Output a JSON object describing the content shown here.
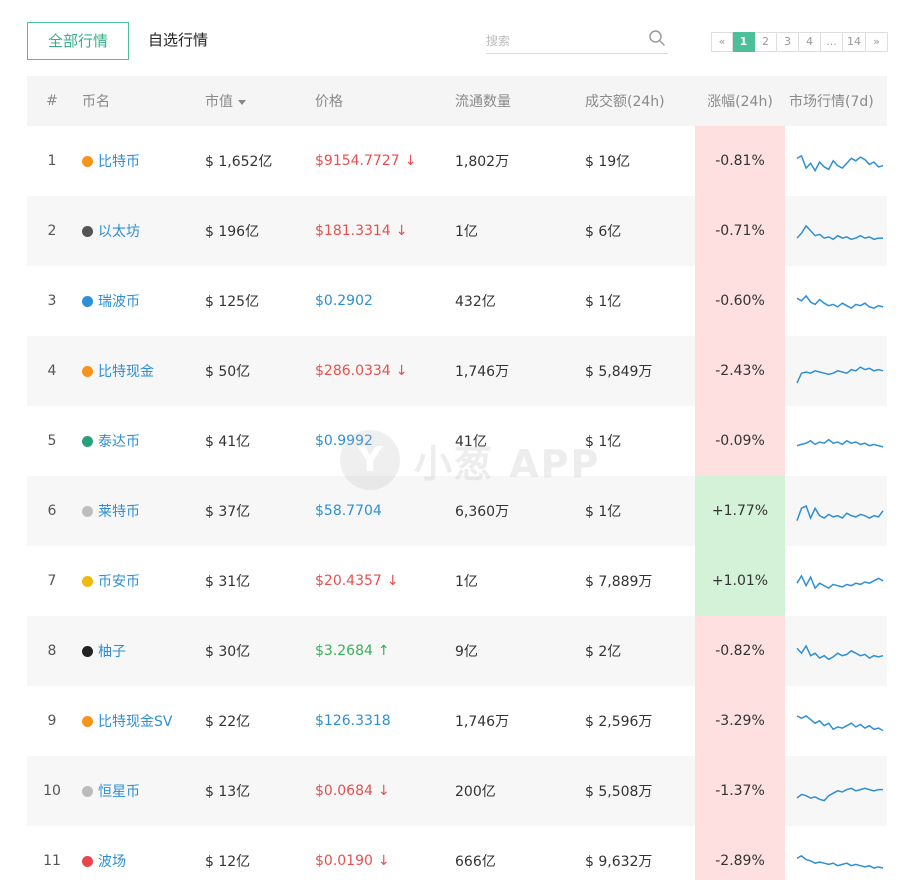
{
  "tabs": [
    {
      "label": "全部行情",
      "active": true
    },
    {
      "label": "自选行情",
      "active": false
    }
  ],
  "search": {
    "placeholder": "搜索",
    "value": ""
  },
  "pagination": {
    "prev_icon": "double-chevron-left-icon",
    "pages": [
      "1",
      "2",
      "3",
      "4",
      "...",
      "14"
    ],
    "current": "1",
    "next_icon": "double-chevron-right-icon"
  },
  "table": {
    "headers": {
      "rank": "#",
      "name": "币名",
      "market_cap": "市值",
      "price": "价格",
      "supply": "流通数量",
      "volume": "成交额(24h)",
      "change": "涨幅(24h)",
      "trend": "市场行情(7d)"
    },
    "rows": [
      {
        "rank": "1",
        "name": "比特币",
        "icon": "bitcoin-icon",
        "icon_color": "#f7931a",
        "market_cap": "$ 1,652亿",
        "price": "$9154.7727",
        "price_dir": "down",
        "supply": "1,802万",
        "volume": "$ 19亿",
        "change": "-0.81%",
        "change_dir": "neg",
        "spark": [
          6,
          4,
          14,
          10,
          16,
          9,
          13,
          15,
          8,
          12,
          14,
          10,
          6,
          8,
          5,
          7,
          11,
          9,
          13,
          12
        ],
        "spark_max": 18
      },
      {
        "rank": "2",
        "name": "以太坊",
        "icon": "ethereum-icon",
        "icon_color": "#555555",
        "market_cap": "$ 196亿",
        "price": "$181.3314",
        "price_dir": "down",
        "supply": "1亿",
        "volume": "$ 6亿",
        "change": "-0.71%",
        "change_dir": "neg",
        "spark": [
          14,
          10,
          4,
          8,
          12,
          11,
          14,
          13,
          15,
          12,
          14,
          13,
          15,
          14,
          12,
          14,
          13,
          15,
          14,
          14
        ],
        "spark_max": 18
      },
      {
        "rank": "3",
        "name": "瑞波币",
        "icon": "ripple-icon",
        "icon_color": "#2d8fd5",
        "market_cap": "$ 125亿",
        "price": "$0.2902",
        "price_dir": "flat",
        "supply": "432亿",
        "volume": "$ 1亿",
        "change": "-0.60%",
        "change_dir": "neg",
        "spark": [
          6,
          8,
          4,
          9,
          11,
          7,
          10,
          12,
          11,
          13,
          10,
          12,
          14,
          11,
          12,
          10,
          13,
          14,
          12,
          13
        ],
        "spark_max": 18
      },
      {
        "rank": "4",
        "name": "比特现金",
        "icon": "bitcoin-cash-icon",
        "icon_color": "#f7931a",
        "market_cap": "$ 50亿",
        "price": "$286.0334",
        "price_dir": "down",
        "supply": "1,746万",
        "volume": "$ 5,849万",
        "change": "-2.43%",
        "change_dir": "neg",
        "spark": [
          18,
          10,
          9,
          10,
          8,
          9,
          10,
          11,
          10,
          8,
          9,
          10,
          7,
          8,
          5,
          7,
          6,
          8,
          7,
          8
        ],
        "spark_max": 18
      },
      {
        "rank": "5",
        "name": "泰达币",
        "icon": "tether-icon",
        "icon_color": "#26a17b",
        "market_cap": "$ 41亿",
        "price": "$0.9992",
        "price_dir": "flat",
        "supply": "41亿",
        "volume": "$ 1亿",
        "change": "-0.09%",
        "change_dir": "neg",
        "spark": [
          12,
          11,
          10,
          8,
          11,
          9,
          10,
          7,
          10,
          9,
          11,
          8,
          10,
          9,
          11,
          10,
          12,
          11,
          12,
          13
        ],
        "spark_max": 18
      },
      {
        "rank": "6",
        "name": "莱特币",
        "icon": "litecoin-icon",
        "icon_color": "#bebebe",
        "market_cap": "$ 37亿",
        "price": "$58.7704",
        "price_dir": "flat",
        "supply": "6,360万",
        "volume": "$ 1亿",
        "change": "+1.77%",
        "change_dir": "pos",
        "spark": [
          16,
          6,
          4,
          14,
          6,
          12,
          14,
          11,
          13,
          12,
          14,
          10,
          12,
          13,
          11,
          12,
          14,
          12,
          13,
          8
        ],
        "spark_max": 18
      },
      {
        "rank": "7",
        "name": "币安币",
        "icon": "binance-icon",
        "icon_color": "#f0b90b",
        "market_cap": "$ 31亿",
        "price": "$20.4357",
        "price_dir": "down",
        "supply": "1亿",
        "volume": "$ 7,889万",
        "change": "+1.01%",
        "change_dir": "pos",
        "spark": [
          10,
          4,
          12,
          5,
          14,
          10,
          12,
          14,
          11,
          12,
          13,
          11,
          12,
          10,
          11,
          9,
          10,
          8,
          6,
          8
        ],
        "spark_max": 18
      },
      {
        "rank": "8",
        "name": "柚子",
        "icon": "eos-icon",
        "icon_color": "#222222",
        "market_cap": "$ 30亿",
        "price": "$3.2684",
        "price_dir": "up",
        "supply": "9亿",
        "volume": "$ 2亿",
        "change": "-0.82%",
        "change_dir": "neg",
        "spark": [
          6,
          10,
          4,
          12,
          10,
          14,
          12,
          15,
          13,
          10,
          12,
          11,
          8,
          10,
          12,
          11,
          14,
          12,
          13,
          12
        ],
        "spark_max": 18
      },
      {
        "rank": "9",
        "name": "比特现金SV",
        "icon": "bitcoin-sv-icon",
        "icon_color": "#f7931a",
        "market_cap": "$ 22亿",
        "price": "$126.3318",
        "price_dir": "flat",
        "supply": "1,746万",
        "volume": "$ 2,596万",
        "change": "-3.29%",
        "change_dir": "neg",
        "spark": [
          4,
          6,
          4,
          7,
          10,
          8,
          12,
          10,
          15,
          13,
          14,
          12,
          10,
          13,
          11,
          14,
          12,
          15,
          14,
          16
        ],
        "spark_max": 18
      },
      {
        "rank": "10",
        "name": "恒星币",
        "icon": "stellar-icon",
        "icon_color": "#bbbbbb",
        "market_cap": "$ 13亿",
        "price": "$0.0684",
        "price_dir": "down",
        "supply": "200亿",
        "volume": "$ 5,508万",
        "change": "-1.37%",
        "change_dir": "neg",
        "spark": [
          14,
          11,
          12,
          14,
          13,
          15,
          16,
          12,
          10,
          8,
          9,
          7,
          6,
          8,
          7,
          6,
          7,
          8,
          7,
          7
        ],
        "spark_max": 18
      },
      {
        "rank": "11",
        "name": "波场",
        "icon": "tron-icon",
        "icon_color": "#e8464b",
        "market_cap": "$ 12亿",
        "price": "$0.0190",
        "price_dir": "down",
        "supply": "666亿",
        "volume": "$ 9,632万",
        "change": "-2.89%",
        "change_dir": "neg",
        "spark": [
          6,
          4,
          7,
          8,
          10,
          9,
          10,
          11,
          10,
          12,
          11,
          10,
          12,
          11,
          12,
          13,
          12,
          14,
          13,
          14
        ],
        "spark_max": 18
      }
    ]
  },
  "arrows": {
    "down": "↓",
    "up": "↑"
  },
  "watermark": {
    "logo_letter": "Y",
    "text": "小葱 APP"
  },
  "colors": {
    "accent": "#4dbf9b",
    "link": "#2d8fd5",
    "down": "#e65050",
    "up": "#37b05b",
    "neg_bg": "#fde0df",
    "pos_bg": "#d4f2d8",
    "spark": "#2d8fd5"
  }
}
